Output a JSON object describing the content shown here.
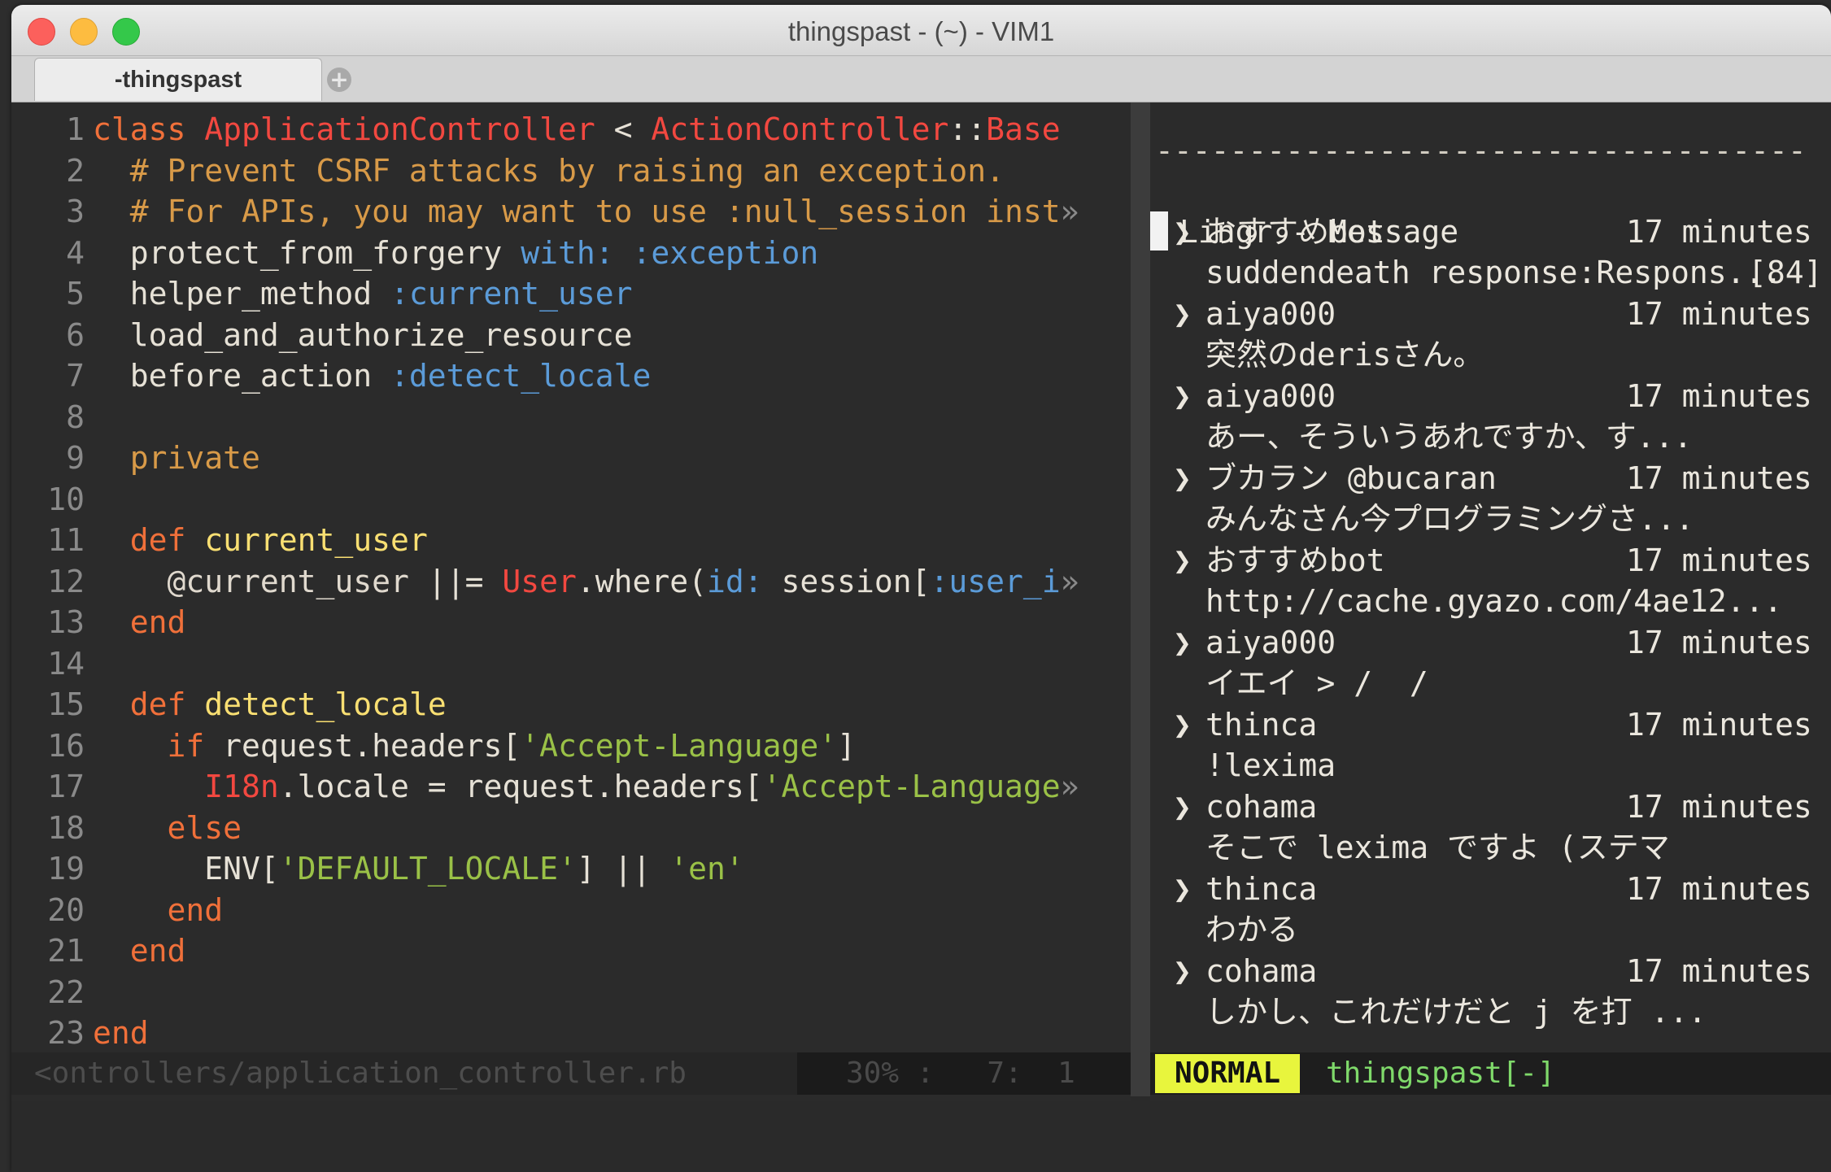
{
  "window": {
    "title": "thingspast - (~) - VIM1"
  },
  "tabs": {
    "active_label": "-thingspast"
  },
  "editor": {
    "lines": [
      {
        "n": "1",
        "segs": [
          {
            "t": "class ",
            "c": "kw"
          },
          {
            "t": "ApplicationController",
            "c": "ty"
          },
          {
            "t": " < ",
            "c": ""
          },
          {
            "t": "ActionController",
            "c": "ty"
          },
          {
            "t": "::",
            "c": ""
          },
          {
            "t": "Base",
            "c": "ty"
          }
        ]
      },
      {
        "n": "2",
        "segs": [
          {
            "t": "  # Prevent CSRF attacks by raising an exception.",
            "c": "cm"
          }
        ]
      },
      {
        "n": "3",
        "segs": [
          {
            "t": "  # For APIs, you may want to use :null_session inst",
            "c": "cm"
          },
          {
            "t": "»",
            "c": "ov"
          }
        ]
      },
      {
        "n": "4",
        "segs": [
          {
            "t": "  protect_from_forgery ",
            "c": ""
          },
          {
            "t": "with:",
            "c": "sy"
          },
          {
            "t": " ",
            "c": ""
          },
          {
            "t": ":exception",
            "c": "sy"
          }
        ]
      },
      {
        "n": "5",
        "segs": [
          {
            "t": "  helper_method ",
            "c": ""
          },
          {
            "t": ":current_user",
            "c": "sy"
          }
        ]
      },
      {
        "n": "6",
        "segs": [
          {
            "t": "  load_and_authorize_resource",
            "c": ""
          }
        ]
      },
      {
        "n": "7",
        "segs": [
          {
            "t": "  before_action ",
            "c": ""
          },
          {
            "t": ":detect_locale",
            "c": "sy"
          }
        ]
      },
      {
        "n": "8",
        "segs": []
      },
      {
        "n": "9",
        "segs": [
          {
            "t": "  private",
            "c": "cm"
          }
        ]
      },
      {
        "n": "10",
        "segs": []
      },
      {
        "n": "11",
        "segs": [
          {
            "t": "  def ",
            "c": "kw"
          },
          {
            "t": "current_user",
            "c": "df"
          }
        ]
      },
      {
        "n": "12",
        "segs": [
          {
            "t": "    @current_user ",
            "c": "iv"
          },
          {
            "t": "||= ",
            "c": ""
          },
          {
            "t": "User",
            "c": "ty"
          },
          {
            "t": ".where(",
            "c": ""
          },
          {
            "t": "id:",
            "c": "sy"
          },
          {
            "t": " session[",
            "c": ""
          },
          {
            "t": ":user_i",
            "c": "sy"
          },
          {
            "t": "»",
            "c": "ov"
          }
        ]
      },
      {
        "n": "13",
        "segs": [
          {
            "t": "  end",
            "c": "kw"
          }
        ]
      },
      {
        "n": "14",
        "segs": []
      },
      {
        "n": "15",
        "segs": [
          {
            "t": "  def ",
            "c": "kw"
          },
          {
            "t": "detect_locale",
            "c": "df"
          }
        ]
      },
      {
        "n": "16",
        "segs": [
          {
            "t": "    if ",
            "c": "kw"
          },
          {
            "t": "request.headers[",
            "c": ""
          },
          {
            "t": "'Accept-Language'",
            "c": "st"
          },
          {
            "t": "]",
            "c": ""
          }
        ]
      },
      {
        "n": "17",
        "segs": [
          {
            "t": "      I18n",
            "c": "ty"
          },
          {
            "t": ".locale = request.headers[",
            "c": ""
          },
          {
            "t": "'Accept-Language",
            "c": "st"
          },
          {
            "t": "»",
            "c": "ov"
          }
        ]
      },
      {
        "n": "18",
        "segs": [
          {
            "t": "    else",
            "c": "kw"
          }
        ]
      },
      {
        "n": "19",
        "segs": [
          {
            "t": "      ENV[",
            "c": ""
          },
          {
            "t": "'DEFAULT_LOCALE'",
            "c": "st"
          },
          {
            "t": "] || ",
            "c": ""
          },
          {
            "t": "'en'",
            "c": "st"
          }
        ]
      },
      {
        "n": "20",
        "segs": [
          {
            "t": "    end",
            "c": "kw"
          }
        ]
      },
      {
        "n": "21",
        "segs": [
          {
            "t": "  end",
            "c": "kw"
          }
        ]
      },
      {
        "n": "22",
        "segs": []
      },
      {
        "n": "23",
        "segs": [
          {
            "t": "end",
            "c": "kw"
          }
        ]
      }
    ],
    "status_file": "<ontrollers/application_controller.rb",
    "status_pos": "30% :   7:  1"
  },
  "lingr": {
    "separator": "-----------------------------------",
    "title": "Lingr - Message",
    "count": "[84]",
    "messages": [
      {
        "user": "おすすめbot",
        "time": "17 minutes",
        "text": "suddendeath response:Respons..."
      },
      {
        "user": "aiya000",
        "time": "17 minutes",
        "text": "突然のderisさん。"
      },
      {
        "user": "aiya000",
        "time": "17 minutes",
        "text": "あー、そういうあれですか、す..."
      },
      {
        "user": "ブカラン @bucaran",
        "time": "17 minutes",
        "text": "みんなさん今プログラミングさ..."
      },
      {
        "user": "おすすめbot",
        "time": "17 minutes",
        "text": "http://cache.gyazo.com/4ae12..."
      },
      {
        "user": "aiya000",
        "time": "17 minutes",
        "text": "イエイ > /  /"
      },
      {
        "user": "thinca",
        "time": "17 minutes",
        "text": "!lexima"
      },
      {
        "user": "cohama",
        "time": "17 minutes",
        "text": "そこで lexima ですよ (ステマ"
      },
      {
        "user": "thinca",
        "time": "17 minutes",
        "text": "わかる"
      },
      {
        "user": "cohama",
        "time": "17 minutes",
        "text": "しかし、これだけだと j を打 ..."
      }
    ],
    "arrow_glyph": "❯",
    "mode": "NORMAL",
    "buffer_name": "thingspast[-]"
  },
  "icons": {
    "close": "close-dot",
    "minimize": "minimize-dot",
    "zoom": "zoom-dot",
    "add_tab": "plus-circle-icon"
  }
}
